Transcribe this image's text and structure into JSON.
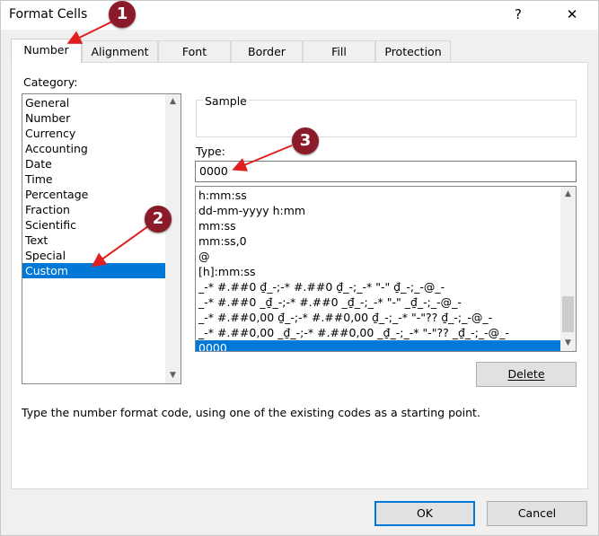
{
  "window": {
    "title": "Format Cells",
    "help_icon": "?",
    "close_icon": "✕"
  },
  "tabs": [
    "Number",
    "Alignment",
    "Font",
    "Border",
    "Fill",
    "Protection"
  ],
  "category": {
    "label": "Category:",
    "items": [
      "General",
      "Number",
      "Currency",
      "Accounting",
      "Date",
      "Time",
      "Percentage",
      "Fraction",
      "Scientific",
      "Text",
      "Special",
      "Custom"
    ],
    "selected": "Custom"
  },
  "sample": {
    "label": "Sample",
    "value": ""
  },
  "type": {
    "label": "Type:",
    "value": "0000",
    "formats": [
      "h:mm:ss",
      "dd-mm-yyyy h:mm",
      "mm:ss",
      "mm:ss,0",
      "@",
      "[h]:mm:ss",
      "_-* #.##0 ₫_-;-* #.##0 ₫_-;_-* \"-\" ₫_-;_-@_-",
      "_-* #.##0 _₫_-;-* #.##0 _₫_-;_-* \"-\" _₫_-;_-@_-",
      "_-* #.##0,00 ₫_-;-* #.##0,00 ₫_-;_-* \"-\"?? ₫_-;_-@_-",
      "_-* #.##0,00 _₫_-;-* #.##0,00 _₫_-;_-* \"-\"?? _₫_-;_-@_-",
      "0000"
    ],
    "selected": "0000"
  },
  "buttons": {
    "delete": "Delete",
    "ok": "OK",
    "cancel": "Cancel"
  },
  "description": "Type the number format code, using one of the existing codes as a starting point.",
  "annotations": [
    "1",
    "2",
    "3"
  ],
  "colors": {
    "accent": "#0078d7",
    "annotation": "#8b1a2b",
    "arrow": "#e02020"
  }
}
